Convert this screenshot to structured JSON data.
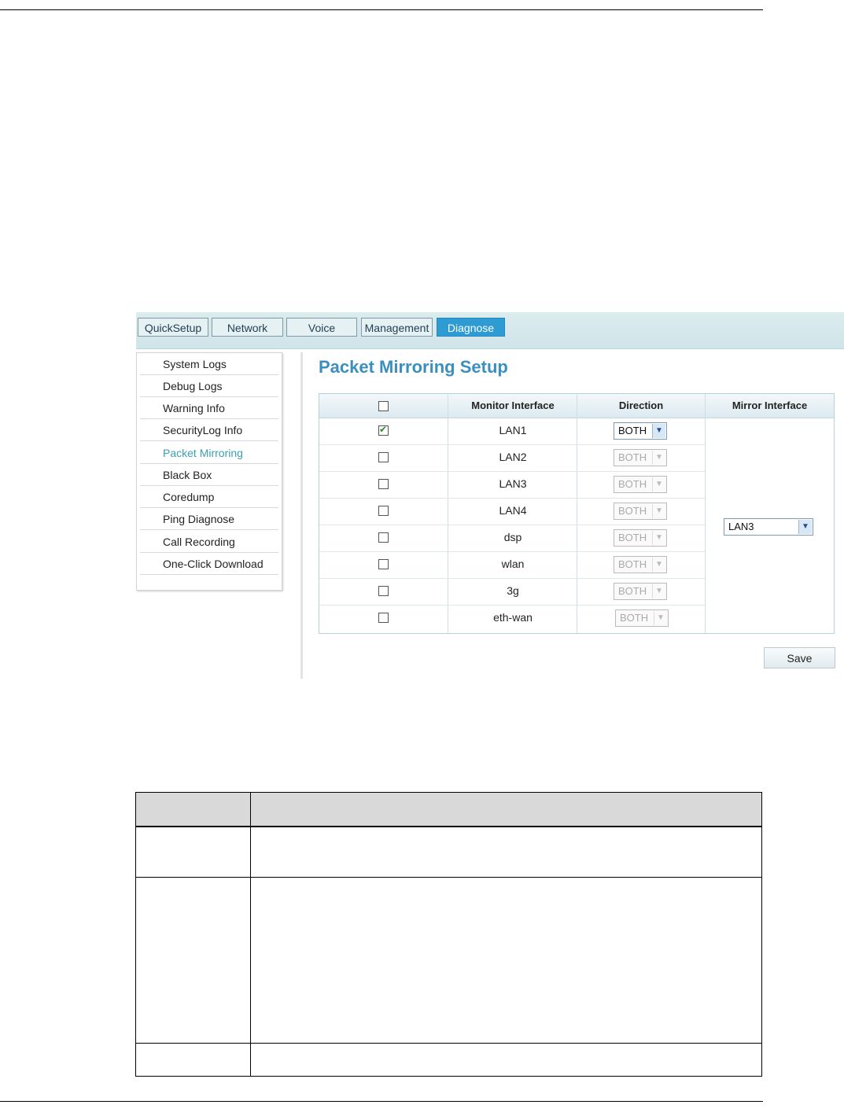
{
  "tabs": [
    "QuickSetup",
    "Network",
    "Voice",
    "Management",
    "Diagnose"
  ],
  "active_tab": "Diagnose",
  "menu": [
    "System Logs",
    "Debug Logs",
    "Warning Info",
    "SecurityLog Info",
    "Packet Mirroring",
    "Black Box",
    "Coredump",
    "Ping Diagnose",
    "Call Recording",
    "One-Click Download"
  ],
  "active_menu": "Packet Mirroring",
  "page_title": "Packet Mirroring Setup",
  "table": {
    "headers": [
      "Monitor Interface",
      "Direction",
      "Mirror Interface"
    ],
    "rows": [
      {
        "iface": "LAN1",
        "checked": true,
        "direction": "BOTH",
        "enabled": true
      },
      {
        "iface": "LAN2",
        "checked": false,
        "direction": "BOTH",
        "enabled": false
      },
      {
        "iface": "LAN3",
        "checked": false,
        "direction": "BOTH",
        "enabled": false
      },
      {
        "iface": "LAN4",
        "checked": false,
        "direction": "BOTH",
        "enabled": false
      },
      {
        "iface": "dsp",
        "checked": false,
        "direction": "BOTH",
        "enabled": false
      },
      {
        "iface": "wlan",
        "checked": false,
        "direction": "BOTH",
        "enabled": false
      },
      {
        "iface": "3g",
        "checked": false,
        "direction": "BOTH",
        "enabled": false
      },
      {
        "iface": "eth-wan",
        "checked": false,
        "direction": "BOTH",
        "enabled": false
      }
    ],
    "mirror_interface": "LAN3"
  },
  "save_label": "Save"
}
